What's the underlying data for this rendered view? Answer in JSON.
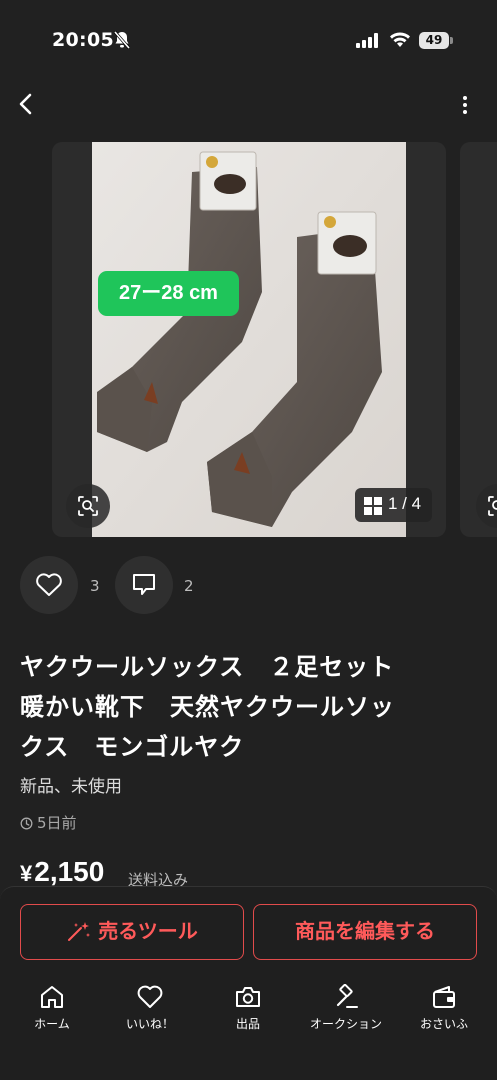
{
  "status_bar": {
    "time": "20:05",
    "battery": "49"
  },
  "carousel": {
    "size_tag": "27ー28 cm",
    "page_indicator": "1 / 4"
  },
  "actions": {
    "like_count": "3",
    "comment_count": "2"
  },
  "product": {
    "title_line1": "ヤクウールソックス　２足セット",
    "title_line2": "暖かい靴下　天然ヤクウールソッ",
    "title_line3": "クス　モンゴルヤク",
    "condition": "新品、未使用",
    "posted": "5日前",
    "price_symbol": "¥",
    "price": "2,150",
    "shipping": "送料込み"
  },
  "buttons": {
    "sell_tool": "売るツール",
    "edit_item": "商品を編集する"
  },
  "tabbar": {
    "home": "ホーム",
    "likes": "いいね！",
    "sell": "出品",
    "auction": "オークション",
    "wallet": "おさいふ"
  },
  "colors": {
    "background": "#212121",
    "accent": "#e14b4b",
    "size_tag": "#1fc55a"
  },
  "icons": [
    "bell-slash-icon",
    "signal-icon",
    "wifi-icon",
    "battery-icon",
    "back-arrow-icon",
    "more-vertical-icon",
    "lens-search-icon",
    "grid-icon",
    "heart-icon",
    "comment-icon",
    "clock-icon",
    "sparkle-wand-icon",
    "home-icon",
    "heart-icon",
    "camera-icon",
    "gavel-icon",
    "wallet-icon"
  ]
}
